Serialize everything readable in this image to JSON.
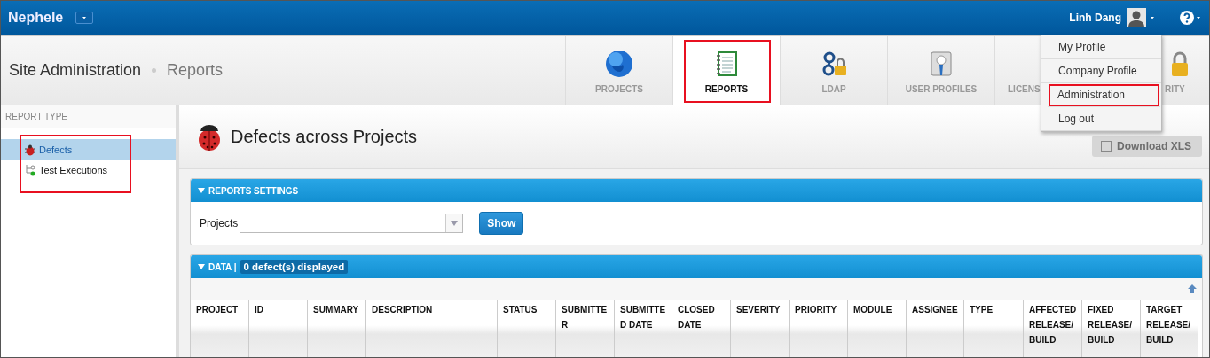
{
  "app": {
    "title": "Nephele",
    "user": "Linh Dang"
  },
  "header": {
    "breadcrumb": [
      {
        "label": "Site Administration",
        "current": false
      },
      {
        "label": "Reports",
        "current": true
      }
    ]
  },
  "tabs": [
    {
      "label": "PROJECTS",
      "kind": "globe",
      "selected": false,
      "highlighted": false
    },
    {
      "label": "REPORTS",
      "kind": "notebook",
      "selected": true,
      "highlighted": true
    },
    {
      "label": "LDAP",
      "kind": "ldap",
      "selected": false,
      "highlighted": false
    },
    {
      "label": "USER PROFILES",
      "kind": "profile",
      "selected": false,
      "highlighted": false
    },
    {
      "label": "LICENS",
      "kind": "none",
      "selected": false,
      "highlighted": false
    },
    {
      "label": "RITY",
      "kind": "lock",
      "selected": false,
      "highlighted": false
    }
  ],
  "user_menu": {
    "items": [
      {
        "label": "My Profile",
        "highlighted": false
      },
      {
        "label": "Company Profile",
        "highlighted": false
      },
      {
        "label": "Administration",
        "highlighted": true
      },
      {
        "label": "Log out",
        "highlighted": false
      }
    ]
  },
  "sidebar": {
    "heading": "REPORT TYPE",
    "highlighted": true,
    "items": [
      {
        "label": "Defects",
        "kind": "bug",
        "selected": true
      },
      {
        "label": "Test Executions",
        "kind": "tree",
        "selected": false
      }
    ]
  },
  "page": {
    "title": "Defects across Projects",
    "download_button": {
      "label": "Download XLS",
      "disabled": true
    }
  },
  "settings_panel": {
    "title": "REPORTS SETTINGS",
    "projects_label": "Projects",
    "show_button": "Show"
  },
  "data_panel": {
    "title": "DATA |",
    "count_badge": "0 defect(s) displayed",
    "columns": [
      "PROJECT",
      "ID",
      "SUMMARY",
      "DESCRIPTION",
      "STATUS",
      "SUBMITTER",
      "SUBMITTED DATE",
      "CLOSED DATE",
      "SEVERITY",
      "PRIORITY",
      "MODULE",
      "ASSIGNEE",
      "TYPE",
      "AFFECTED RELEASE/ BUILD",
      "FIXED RELEASE/ BUILD",
      "TARGET RELEASE/ BUILD"
    ]
  }
}
